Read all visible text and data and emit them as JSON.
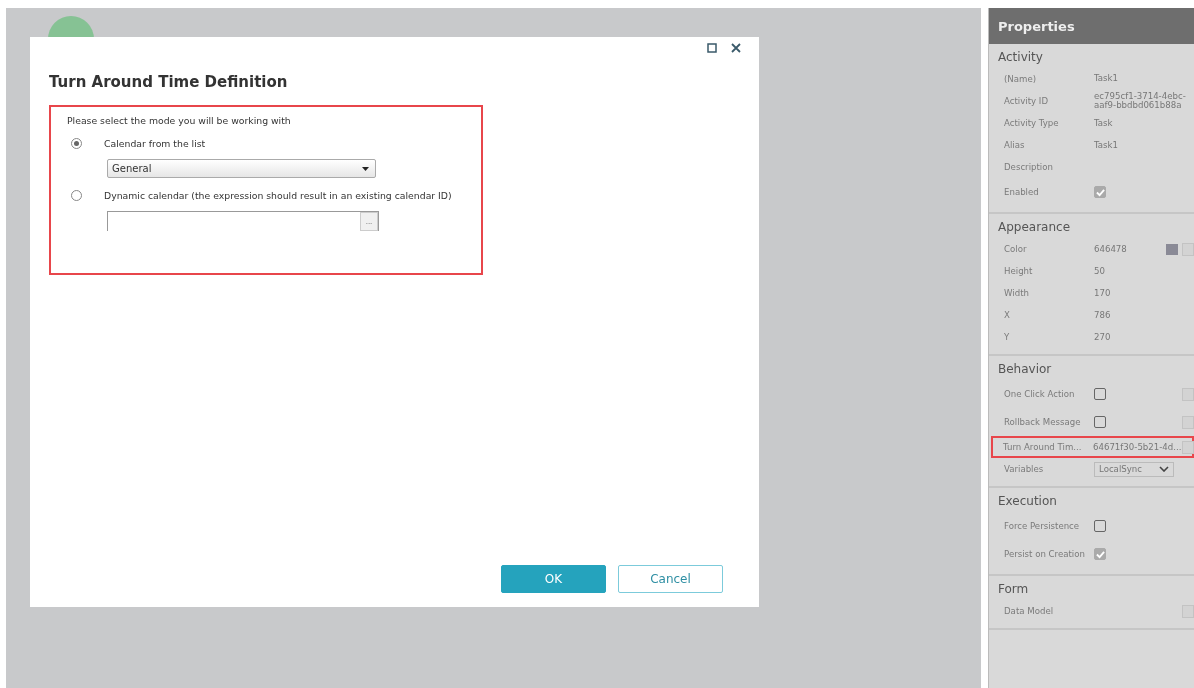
{
  "dialog": {
    "title": "Turn Around Time Definition",
    "highlighted": true,
    "prompt": "Please select the mode you will be working with",
    "options": [
      {
        "label": "Calendar from the list",
        "selected": true,
        "kind": "select",
        "value": "General"
      },
      {
        "label": "Dynamic calendar (the expression should result in an existing calendar ID)",
        "selected": false,
        "kind": "expression",
        "button": "..."
      }
    ],
    "buttons": [
      {
        "label": "OK",
        "kind": "primary"
      },
      {
        "label": "Cancel",
        "kind": "secondary"
      }
    ]
  },
  "properties": {
    "title": "Properties",
    "sections": [
      {
        "title": "Activity",
        "rows": [
          {
            "label": "(Name)",
            "kind": "text",
            "value": "Task1"
          },
          {
            "label": "Activity ID",
            "kind": "text",
            "value": "ec795cf1-3714-4ebc-aaf9-bbdbd061b88a"
          },
          {
            "label": "Activity Type",
            "kind": "text",
            "value": "Task"
          },
          {
            "label": "Alias",
            "kind": "text",
            "value": "Task1"
          },
          {
            "label": "Description",
            "kind": "text"
          },
          {
            "label": "Enabled",
            "kind": "check",
            "checked": true,
            "disabled": true
          }
        ]
      },
      {
        "title": "Appearance",
        "rows": [
          {
            "label": "Color",
            "kind": "color",
            "value": "646478",
            "color": "#8a8a96"
          },
          {
            "label": "Height",
            "kind": "text",
            "value": "50"
          },
          {
            "label": "Width",
            "kind": "text",
            "value": "170"
          },
          {
            "label": "X",
            "kind": "text",
            "value": "786"
          },
          {
            "label": "Y",
            "kind": "text",
            "value": "270"
          }
        ]
      },
      {
        "title": "Behavior",
        "rows": [
          {
            "label": "One Click Action",
            "kind": "check",
            "checked": false,
            "disabled": false,
            "side_button": true
          },
          {
            "label": "Rollback Message",
            "kind": "check",
            "checked": false,
            "disabled": false,
            "side_button": true
          },
          {
            "label": "Turn Around Tim...",
            "kind": "text",
            "value": "64671f30-5b21-4d...",
            "side_button": true,
            "highlighted": true
          },
          {
            "label": "Variables",
            "kind": "select",
            "value": "LocalSync"
          }
        ]
      },
      {
        "title": "Execution",
        "rows": [
          {
            "label": "Force Persistence",
            "kind": "check",
            "checked": false,
            "disabled": false
          },
          {
            "label": "Persist on Creation",
            "kind": "check",
            "checked": true,
            "disabled": true
          }
        ]
      },
      {
        "title": "Form",
        "rows": [
          {
            "label": "Data Model",
            "kind": "text",
            "side_button": true
          }
        ]
      }
    ]
  }
}
